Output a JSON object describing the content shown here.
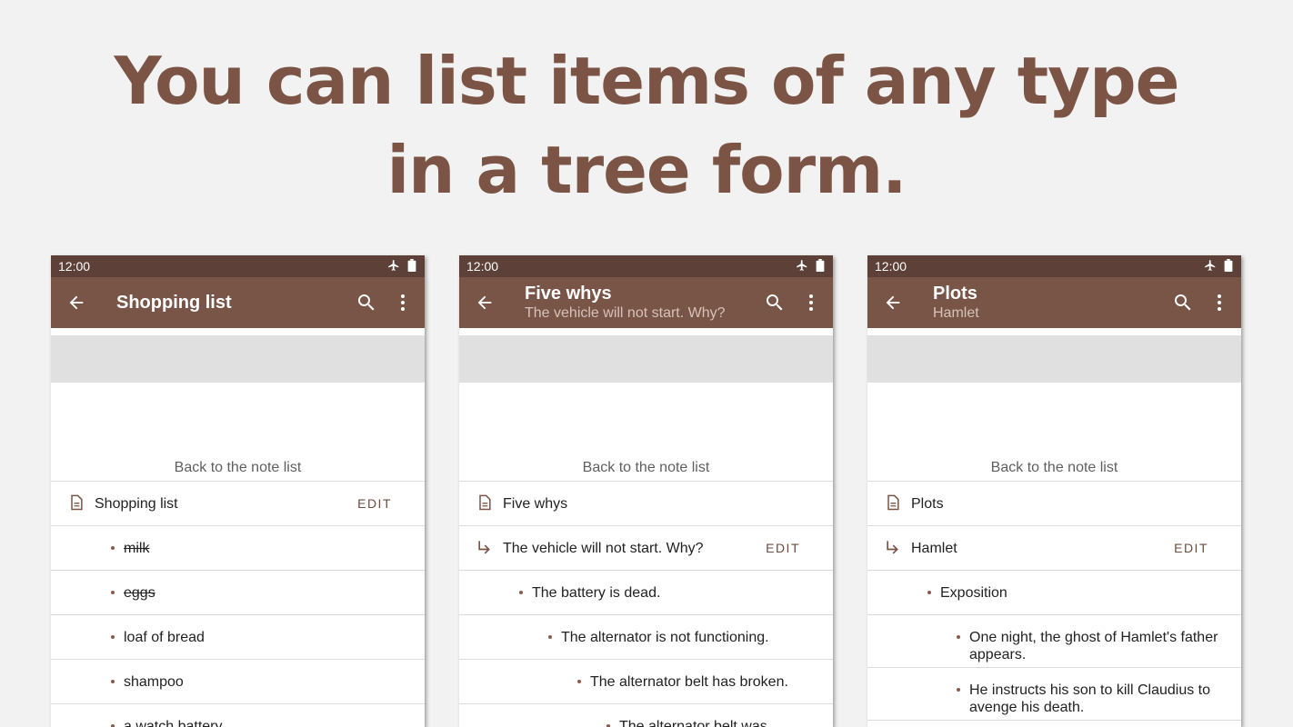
{
  "headline": {
    "line1": "You can list items of any type",
    "line2": "in a tree form."
  },
  "colors": {
    "headline": "#7b5445",
    "statusbar": "#5d4037",
    "appbar": "#795548",
    "bullet": "#8d5a47",
    "edit": "#6d4c41"
  },
  "screens": [
    {
      "status_time": "12:00",
      "title": "Shopping list",
      "subtitle": "",
      "back_link": "Back to the note list",
      "note_title": "Shopping list",
      "edit_label": "EDIT",
      "items": [
        {
          "text": "milk",
          "checked": true
        },
        {
          "text": "eggs",
          "checked": true
        },
        {
          "text": "loaf of bread",
          "checked": false
        },
        {
          "text": "shampoo",
          "checked": false
        },
        {
          "text": "a watch battery",
          "checked": false
        }
      ]
    },
    {
      "status_time": "12:00",
      "title": "Five whys",
      "subtitle": "The vehicle will not start. Why?",
      "back_link": "Back to the note list",
      "note_title": "Five whys",
      "subnote_title": "The vehicle will not start. Why?",
      "edit_label": "EDIT",
      "items": [
        {
          "text": "The battery is dead."
        },
        {
          "text": "The alternator is not functioning."
        },
        {
          "text": "The alternator belt has broken."
        },
        {
          "text": "The alternator belt was beyond"
        }
      ]
    },
    {
      "status_time": "12:00",
      "title": "Plots",
      "subtitle": "Hamlet",
      "back_link": "Back to the note list",
      "note_title": "Plots",
      "subnote_title": "Hamlet",
      "edit_label": "EDIT",
      "items": [
        {
          "text": "Exposition"
        },
        {
          "text": "One night, the ghost of Hamlet's father appears."
        },
        {
          "text": "He instructs his son to kill Claudius to avenge his death."
        }
      ]
    }
  ]
}
